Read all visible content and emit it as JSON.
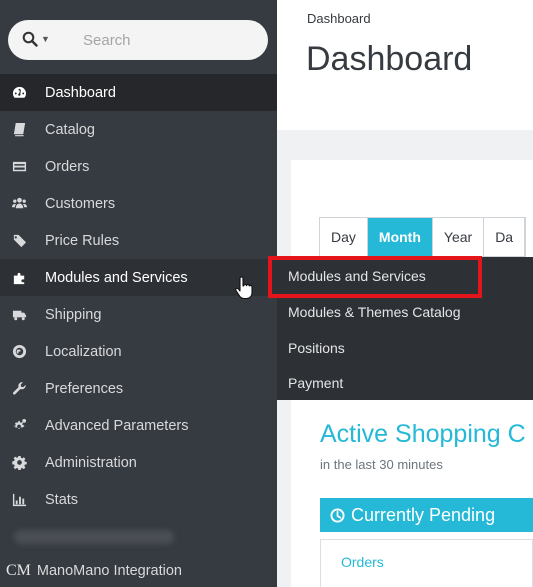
{
  "search": {
    "placeholder": "Search"
  },
  "sidebar": {
    "items": [
      {
        "label": "Dashboard",
        "icon": "dashboard-icon",
        "state": "active"
      },
      {
        "label": "Catalog",
        "icon": "book-icon"
      },
      {
        "label": "Orders",
        "icon": "credit-card-icon"
      },
      {
        "label": "Customers",
        "icon": "users-icon"
      },
      {
        "label": "Price Rules",
        "icon": "tag-icon"
      },
      {
        "label": "Modules and Services",
        "icon": "puzzle-icon",
        "state": "hover"
      },
      {
        "label": "Shipping",
        "icon": "truck-icon"
      },
      {
        "label": "Localization",
        "icon": "globe-icon"
      },
      {
        "label": "Preferences",
        "icon": "wrench-icon"
      },
      {
        "label": "Advanced Parameters",
        "icon": "cogs-icon"
      },
      {
        "label": "Administration",
        "icon": "gear-icon"
      },
      {
        "label": "Stats",
        "icon": "bar-chart-icon"
      }
    ],
    "mano_prefix": "CM",
    "mano_label": "ManoMano Integration"
  },
  "header": {
    "breadcrumb": "Dashboard",
    "title": "Dashboard"
  },
  "period": {
    "day": "Day",
    "month": "Month",
    "year": "Year",
    "more": "Da"
  },
  "submenu": {
    "items": [
      "Modules and Services",
      "Modules & Themes Catalog",
      "Positions",
      "Payment"
    ]
  },
  "active_carts": {
    "title": "Active Shopping C",
    "subtitle": "in the last 30 minutes",
    "pending": "Currently Pending",
    "orders": "Orders"
  },
  "colors": {
    "sidebar": "#363a41",
    "accent": "#25b9d7",
    "highlight": "#e3141a"
  }
}
